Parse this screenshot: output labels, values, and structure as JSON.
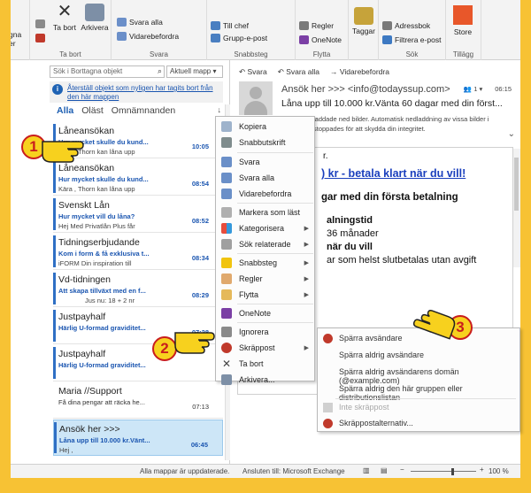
{
  "ribbon": {
    "left_labels": [
      "gna",
      "er"
    ],
    "ta_bort": "Ta bort",
    "arkivera": "Arkivera",
    "svara_alla": "Svara alla",
    "vidarebefordra": "Vidarebefordra",
    "svara_label": "Svara",
    "till_chef": "Till chef",
    "grupp_epost": "Grupp-e-post",
    "snabbsteg_label": "Snabbsteg",
    "regler": "Regler",
    "onenote": "OneNote",
    "flytta_label": "Flytta",
    "taggar": "Taggar",
    "adressbok": "Adressbok",
    "filtrera": "Filtrera e-post",
    "sok_label": "Sök",
    "store": "Store",
    "tillagg_label": "Tillägg",
    "ta_bort_label": "Ta bort"
  },
  "list": {
    "search_placeholder": "Sök i Borttagna objekt",
    "mailbox": "Aktuell mapp",
    "info_text": "Återställ objekt som nyligen har tagits bort från den här mappen",
    "tabs": [
      "Alla",
      "Oläst",
      "Omnämnanden"
    ],
    "mails": [
      {
        "sender": "Låneansökan",
        "subject": "Hur mycket skulle du kund...",
        "time": "10:05",
        "preview": "Kära , Thorn kan låna upp"
      },
      {
        "sender": "Låneansökan",
        "subject": "Hur mycket skulle du kund...",
        "time": "08:54",
        "preview": "Kära , Thorn kan låna upp"
      },
      {
        "sender": "Svenskt Lån",
        "subject": "Hur mycket vill du låna?",
        "time": "08:52",
        "preview": "Hej  Med Privatlån Plus får"
      },
      {
        "sender": "Tidningserbjudande",
        "subject": "Kom i form & få exklusiva t...",
        "time": "08:34",
        "preview": "iFORM  Din inspiration till"
      },
      {
        "sender": "Vd-tidningen",
        "subject": "Att skapa tillväxt med en f...",
        "time": "08:29",
        "preview": "Jus nu: 18 + 2 nr"
      },
      {
        "sender": "Justpayhalf",
        "subject": "Härlig U-formad graviditet...",
        "time": "07:28",
        "preview": ""
      },
      {
        "sender": "Justpayhalf",
        "subject": "Härlig U-formad graviditet...",
        "time": "",
        "preview": ""
      },
      {
        "sender": "Maria //Support",
        "subject": "Få dina pengar att räcka he...",
        "time": "07:13",
        "preview": ""
      },
      {
        "sender": "Ansök her >>>",
        "subject": "Låna upp till 10.000 kr.Vänt...",
        "time": "06:45",
        "preview": "Hej ,"
      }
    ]
  },
  "reading": {
    "actions": [
      "Svara",
      "Svara alla",
      "Vidarebefordra"
    ],
    "from": "Ansök her >>> <info@todayssup.com>",
    "people": "1",
    "time": "06:15",
    "subject": "Låna upp till 10.000 kr.Vänta 60 dagar med din först...",
    "notice": "laddade ned bilder. Automatisk nedladdning av vissa bilder i stoppades för att skydda din integritet.",
    "body_lines": [
      "r.",
      ") kr - betala klart när du vill!",
      "gar med din första betalning",
      "alningstid",
      "36 månader",
      "när du vill",
      "ar som helst slutbetalas utan avgift"
    ]
  },
  "context_menu": {
    "items": [
      "Kopiera",
      "Snabbutskrift",
      "Svara",
      "Svara alla",
      "Vidarebefordra",
      "Markera som läst",
      "Kategorisera",
      "Sök relaterade",
      "Snabbsteg",
      "Regler",
      "Flytta",
      "OneNote",
      "Ignorera",
      "Skräppost",
      "Ta bort",
      "Arkivera..."
    ]
  },
  "submenu": {
    "items": [
      "Spärra avsändare",
      "Spärra aldrig avsändare",
      "Spärra aldrig avsändarens domän (@example.com)",
      "Spärra aldrig den här gruppen eller distributionslistan",
      "Inte skräppost",
      "Skräppostalternativ..."
    ]
  },
  "status": {
    "left": "Alla mappar är uppdaterade.",
    "conn": "Ansluten till: Microsoft Exchange",
    "zoom": "100 %"
  },
  "badges": [
    "1",
    "2",
    "3"
  ],
  "colors": {
    "accent": "#1e5fb2",
    "badge_fill": "#f7d11e",
    "badge_border": "#c91d1d",
    "frame": "#f7c234"
  }
}
